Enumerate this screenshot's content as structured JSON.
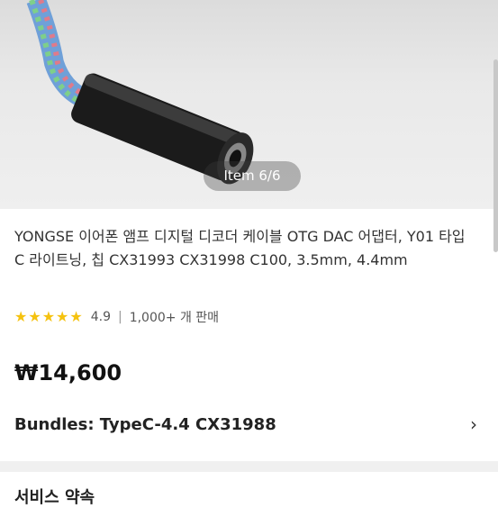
{
  "image": {
    "counter": "Item 6/6"
  },
  "product": {
    "title": "YONGSE 이어폰 앰프 디지털 디코더 케이블 OTG DAC 어댑터, Y01 타입 C 라이트닝, 칩 CX31993 CX31998 C100, 3.5mm, 4.4mm",
    "rating": "4.9",
    "stars": 5,
    "sold": "1,000+ 개 판매",
    "price": "₩14,600",
    "bundles_label": "Bundles: TypeC-4.4 CX31988"
  },
  "section": {
    "title": "서비스 약속"
  },
  "colors": {
    "star": "#f5c20f",
    "divider": "#f0f0f0"
  }
}
